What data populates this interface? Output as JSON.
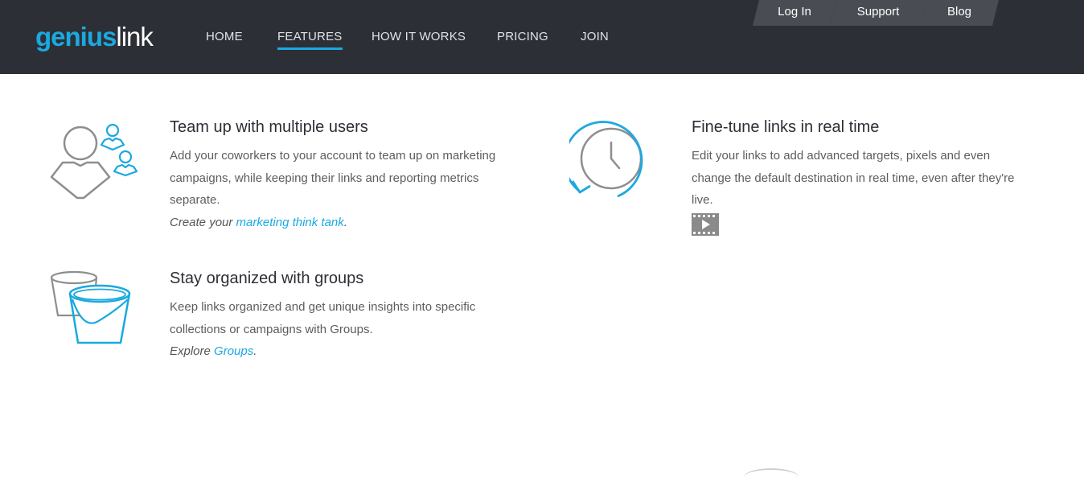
{
  "header": {
    "logo": {
      "part1": "geni",
      "accent": "us",
      "part2": "link"
    },
    "nav": [
      {
        "label": "HOME"
      },
      {
        "label": "FEATURES",
        "active": true
      },
      {
        "label": "HOW IT WORKS"
      },
      {
        "label": "PRICING"
      },
      {
        "label": "JOIN"
      }
    ],
    "top_links": [
      {
        "label": "Log In"
      },
      {
        "label": "Support"
      },
      {
        "label": "Blog"
      }
    ]
  },
  "features": {
    "team": {
      "title": "Team up with multiple users",
      "description": "Add your coworkers to your account to team up on marketing campaigns, while keeping their links and reporting metrics separate.",
      "cta_prefix": "Create your ",
      "cta_link": "marketing think tank",
      "cta_suffix": ".",
      "icon": "users-icon"
    },
    "realtime": {
      "title": "Fine-tune links in real time",
      "description": "Edit your links to add advanced targets, pixels and even change the default destination in real time, even after they're live.",
      "icon": "clock-refresh-icon",
      "video_icon": "video-icon"
    },
    "groups": {
      "title": "Stay organized with groups",
      "description": "Keep links organized and get unique insights into specific collections or campaigns with Groups.",
      "cta_prefix": "Explore ",
      "cta_link": "Groups",
      "cta_suffix": ".",
      "icon": "buckets-icon"
    }
  },
  "colors": {
    "header_bg": "#2d2f36",
    "accent": "#1aa9e0",
    "tab_bg": "#4a4c53"
  }
}
